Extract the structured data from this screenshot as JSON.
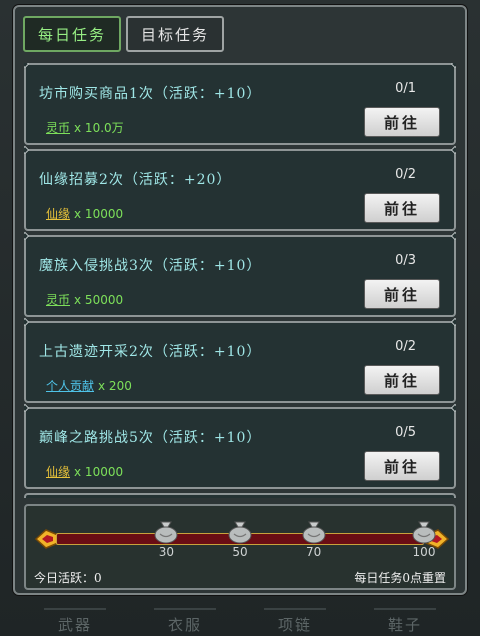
{
  "tabs": [
    {
      "label": "每日任务",
      "active": true
    },
    {
      "label": "目标任务",
      "active": false
    }
  ],
  "tasks": [
    {
      "title": "坊市购买商品1次（活跃：+10）",
      "reward_name": "灵币",
      "reward_color": "#7de05a",
      "reward_amount": "x 10.0万",
      "progress": "0/1",
      "button": "前往"
    },
    {
      "title": "仙缘招募2次（活跃：+20）",
      "reward_name": "仙缘",
      "reward_color": "#e8c23a",
      "reward_amount": "x 10000",
      "progress": "0/2",
      "button": "前往"
    },
    {
      "title": "魔族入侵挑战3次（活跃：+10）",
      "reward_name": "灵币",
      "reward_color": "#7de05a",
      "reward_amount": "x 50000",
      "progress": "0/3",
      "button": "前往"
    },
    {
      "title": "上古遗迹开采2次（活跃：+10）",
      "reward_name": "个人贡献",
      "reward_color": "#4fc3e8",
      "reward_amount": "x 200",
      "progress": "0/2",
      "button": "前往"
    },
    {
      "title": "巅峰之路挑战5次（活跃：+10）",
      "reward_name": "仙缘",
      "reward_color": "#e8c23a",
      "reward_amount": "x 10000",
      "progress": "0/5",
      "button": "前往"
    }
  ],
  "activity": {
    "milestones": [
      "30",
      "50",
      "70",
      "100"
    ],
    "current_value": 0,
    "max_value": 100,
    "today_label": "今日活跃：0",
    "reset_note": "每日任务0点重置"
  },
  "background_tabs": [
    "武器",
    "衣服",
    "项链",
    "鞋子"
  ]
}
